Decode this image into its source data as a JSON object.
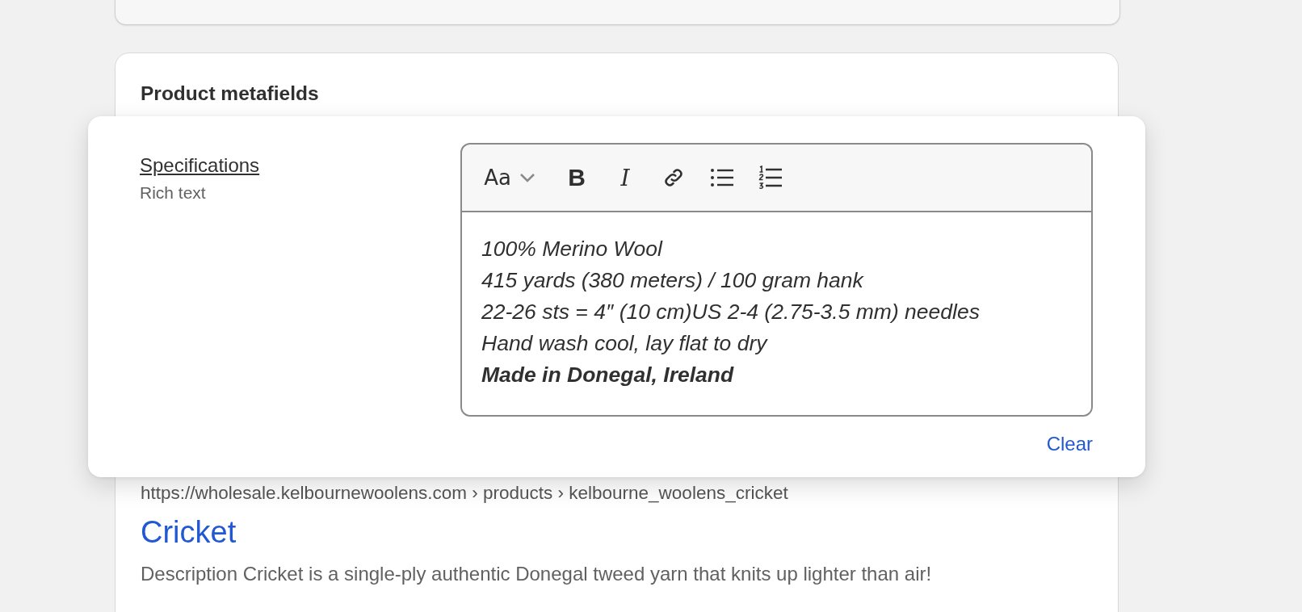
{
  "section": {
    "title": "Product metafields"
  },
  "metafield": {
    "label": "Specifications",
    "type": "Rich text"
  },
  "toolbar": [
    {
      "kind": "format",
      "glyph": "Aa"
    },
    {
      "kind": "chevron"
    },
    {
      "kind": "bold",
      "glyph": "B"
    },
    {
      "kind": "italic",
      "glyph": "I"
    },
    {
      "kind": "link"
    },
    {
      "kind": "bullets"
    },
    {
      "kind": "numbers"
    }
  ],
  "editor": {
    "lines": [
      {
        "text": "100% Merino Wool",
        "bold": false
      },
      {
        "text": "415 yards (380 meters) / 100 gram hank",
        "bold": false
      },
      {
        "text": "22-26 sts = 4″ (10 cm)US 2-4 (2.75-3.5 mm) needles",
        "bold": false
      },
      {
        "text": "Hand wash cool, lay flat to dry",
        "bold": false
      },
      {
        "text": "Made in Donegal, Ireland",
        "bold": true
      }
    ]
  },
  "clear_link": "Clear",
  "search_preview": {
    "url": "https://wholesale.kelbournewoolens.com › products › kelbourne_woolens_cricket",
    "title": "Cricket",
    "description": "Description Cricket is a single-ply authentic Donegal tweed yarn that knits up lighter than air!"
  }
}
